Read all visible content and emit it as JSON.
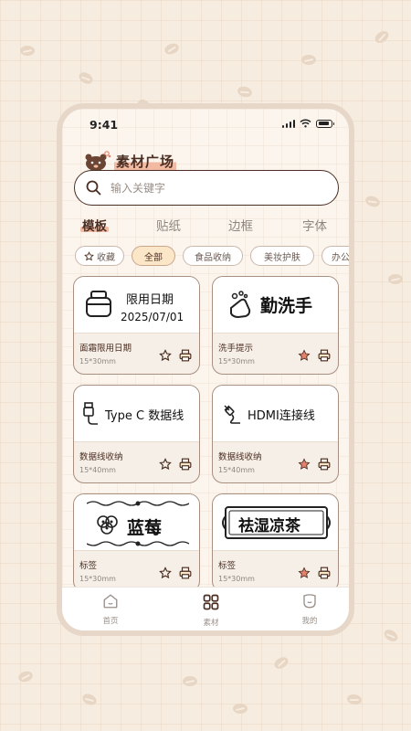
{
  "status_bar": {
    "time": "9:41"
  },
  "brand": {
    "title": "素材广场"
  },
  "search": {
    "placeholder": "输入关键字"
  },
  "tabs": [
    {
      "label": "模板",
      "active": true
    },
    {
      "label": "贴纸",
      "active": false
    },
    {
      "label": "边框",
      "active": false
    },
    {
      "label": "字体",
      "active": false
    }
  ],
  "chips": [
    {
      "label": "收藏",
      "icon": "star-icon",
      "active": false
    },
    {
      "label": "全部",
      "active": true
    },
    {
      "label": "食品收纳",
      "active": false
    },
    {
      "label": "美妆护肤",
      "active": false
    },
    {
      "label": "办公",
      "active": false
    }
  ],
  "cards": [
    {
      "preview_title": "限用日期",
      "preview_date": "2025/07/01",
      "preview_icon": "jar-icon",
      "name": "面霜限用日期",
      "size": "15*30mm",
      "favorited": false
    },
    {
      "preview_title": "勤洗手",
      "preview_icon": "hand-wash-icon",
      "name": "洗手提示",
      "size": "15*30mm",
      "favorited": true
    },
    {
      "preview_title": "Type C 数据线",
      "preview_icon": "usb-cable-icon",
      "name": "数据线收纳",
      "size": "15*40mm",
      "favorited": false
    },
    {
      "preview_title": "HDMI连接线",
      "preview_icon": "plug-cable-icon",
      "name": "数据线收纳",
      "size": "15*40mm",
      "favorited": true
    },
    {
      "preview_title": "蓝莓",
      "preview_icon": "blueberry-icon",
      "name": "标签",
      "size": "15*30mm",
      "favorited": false
    },
    {
      "preview_title": "祛湿凉茶",
      "preview_icon": "ornate-frame-icon",
      "name": "标签",
      "size": "15*30mm",
      "favorited": true
    }
  ],
  "bottom_nav": [
    {
      "label": "首页",
      "icon": "home-icon",
      "active": false
    },
    {
      "label": "素材",
      "icon": "grid-icon",
      "active": true
    },
    {
      "label": "我的",
      "icon": "profile-icon",
      "active": false
    }
  ],
  "colors": {
    "accent": "#f2b9a3",
    "ink": "#4b2e22",
    "star_active": "#e2826b",
    "background": "#f7ece0"
  }
}
